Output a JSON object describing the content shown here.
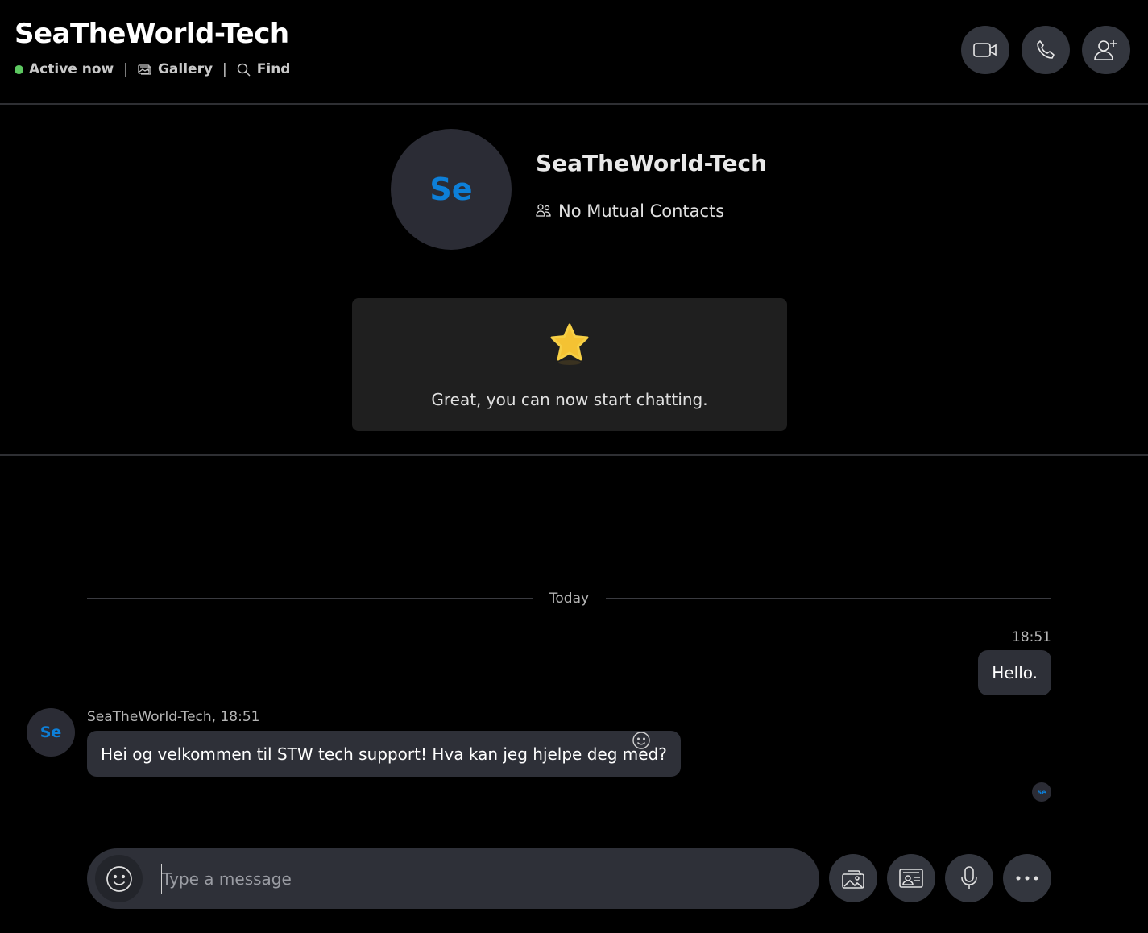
{
  "header": {
    "title": "SeaTheWorld-Tech",
    "status": "Active now",
    "separator": "|",
    "gallery_label": "Gallery",
    "find_label": "Find",
    "buttons": [
      "video-call-icon",
      "audio-call-icon",
      "add-people-icon"
    ],
    "status_color": "#5dc861"
  },
  "profile": {
    "avatar_initials": "Se",
    "name": "SeaTheWorld-Tech",
    "mutual_contacts": "No Mutual Contacts",
    "welcome_icon": "star-icon",
    "welcome_text": "Great, you can now start chatting."
  },
  "conversation": {
    "day_label": "Today",
    "messages": [
      {
        "direction": "outgoing",
        "time": "18:51",
        "text": "Hello."
      },
      {
        "direction": "incoming",
        "sender_meta": "SeaTheWorld-Tech, 18:51",
        "avatar_initials": "Se",
        "text": "Hei og velkommen til STW tech support! Hva kan jeg hjelpe deg med?"
      }
    ],
    "read_receipt_initials": "Se"
  },
  "composer": {
    "placeholder": "Type a message",
    "value": "",
    "tools": [
      "gallery-icon",
      "contact-card-icon",
      "microphone-icon",
      "more-icon"
    ]
  },
  "colors": {
    "background": "#000000",
    "bubble": "#2e3038",
    "button": "#33363e",
    "accent": "#0d7fd8"
  }
}
